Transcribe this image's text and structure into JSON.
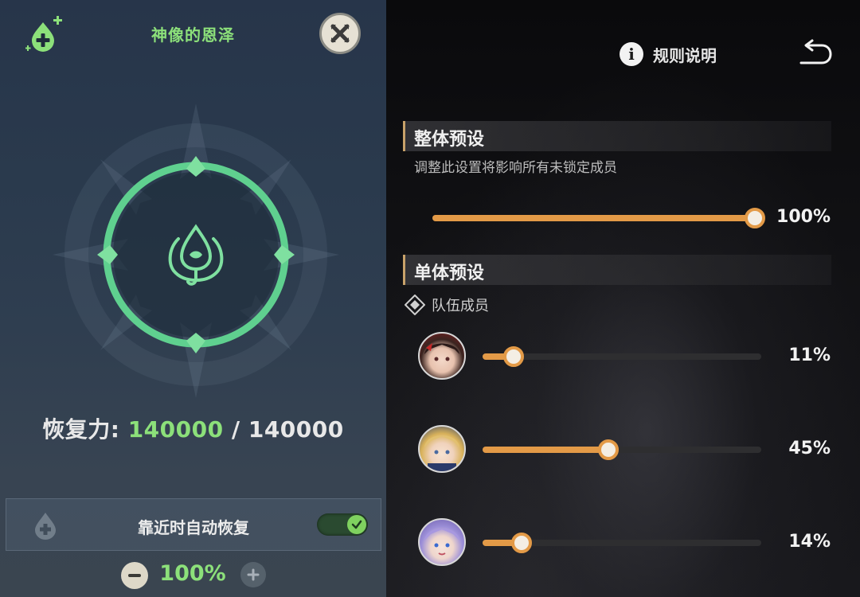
{
  "left_panel": {
    "title": "神像的恩泽",
    "recovery_label": "恢复力: ",
    "recovery_current": "140000",
    "recovery_separator": " / ",
    "recovery_max": "140000",
    "auto_recover_label": "靠近时自动恢复",
    "auto_recover_enabled": true,
    "stepper_value": "100%",
    "accent_color": "#8ce07a"
  },
  "header": {
    "rules_label": "规则说明"
  },
  "overall": {
    "title": "整体预设",
    "description": "调整此设置将影响所有未锁定成员",
    "value_label": "100%",
    "value": 1.0
  },
  "individual": {
    "title": "单体预设",
    "team_label": "队伍成员",
    "members": [
      {
        "avatar": "avatar-dark-hair-red",
        "value_label": "11%",
        "value": 0.11
      },
      {
        "avatar": "avatar-blonde",
        "value_label": "45%",
        "value": 0.45
      },
      {
        "avatar": "avatar-lavender-hair",
        "value_label": "14%",
        "value": 0.14
      }
    ]
  },
  "colors": {
    "slider_fill": "#e39a47",
    "heal_green": "#8ce07a"
  }
}
